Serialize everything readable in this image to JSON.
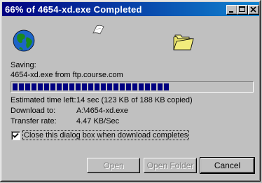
{
  "window": {
    "title": "66% of 4654-xd.exe Completed"
  },
  "titlebar_buttons": [
    "minimize",
    "maximize",
    "close"
  ],
  "status": {
    "saving_label": "Saving:",
    "saving_value": "4654-xd.exe from ftp.course.com",
    "progress_fraction": 0.66
  },
  "details": {
    "time_left_label": "Estimated time left:",
    "time_left_value": "14 sec (123 KB of 188 KB copied)",
    "download_to_label": "Download to:",
    "download_to_value": "A:\\4654-xd.exe",
    "transfer_rate_label": "Transfer rate:",
    "transfer_rate_value": "4.47 KB/Sec"
  },
  "options": {
    "close_on_complete_label": "Close this dialog box when download completes",
    "close_on_complete_checked": true
  },
  "buttons": {
    "open": "Open",
    "open_folder": "Open Folder",
    "cancel": "Cancel"
  },
  "colors": {
    "titlebar": "#000080",
    "progress": "#000080",
    "face": "#c0c0c0"
  },
  "icons": [
    "globe-icon",
    "flying-paper-icon",
    "folder-icon"
  ]
}
